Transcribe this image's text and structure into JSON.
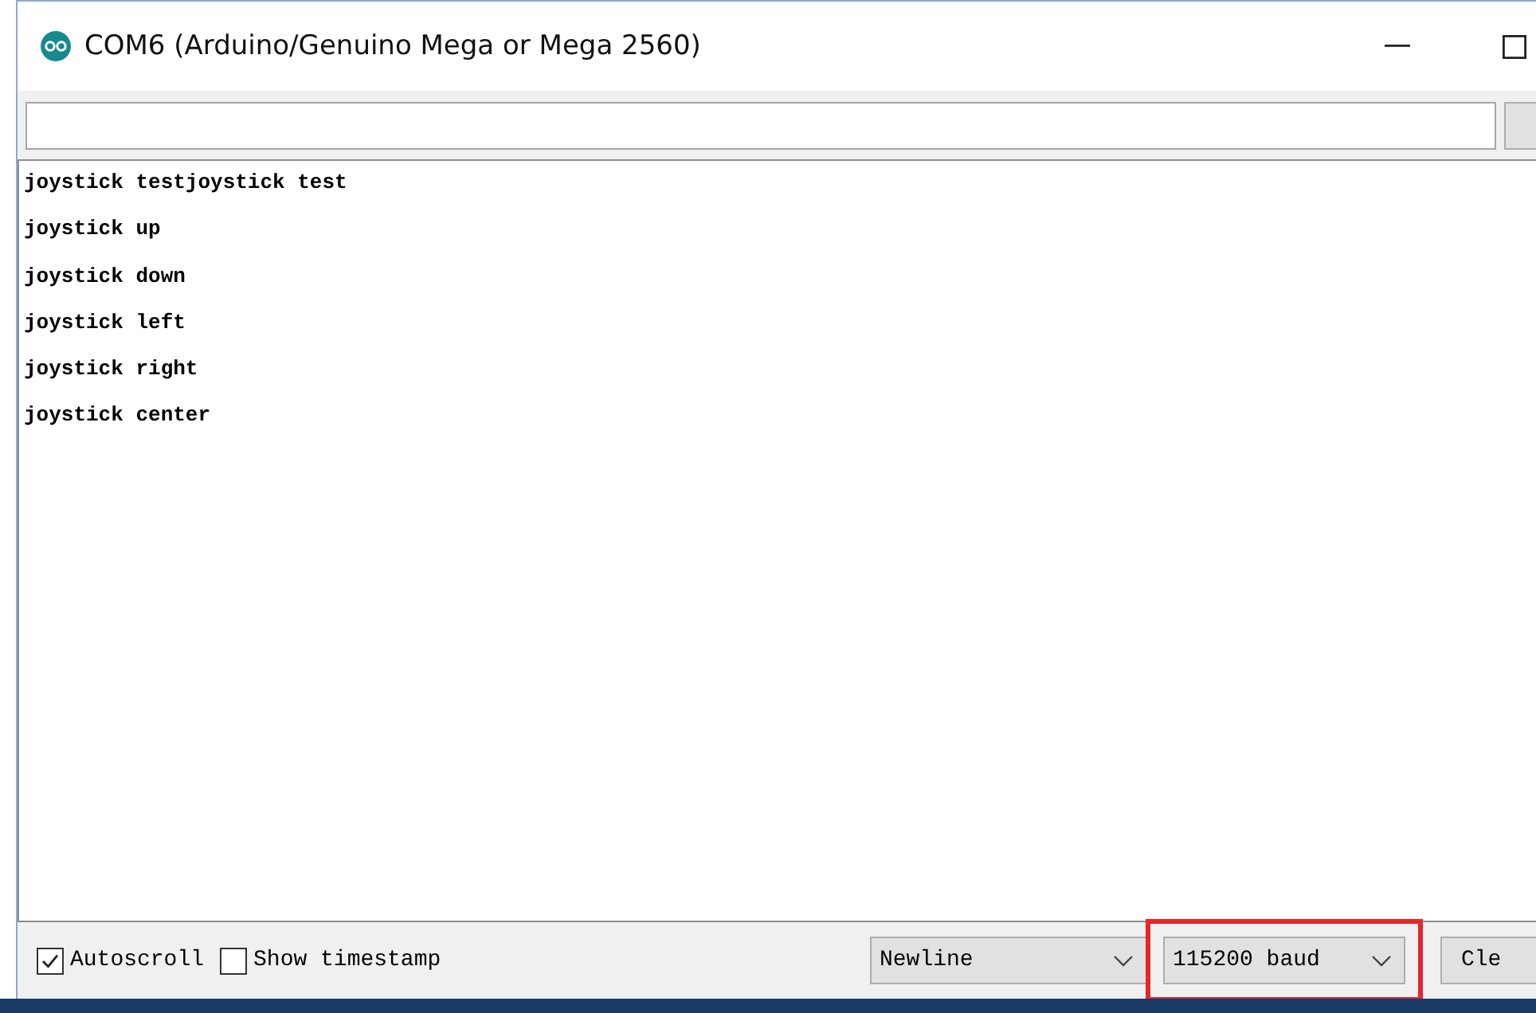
{
  "window": {
    "title": "COM6 (Arduino/Genuino Mega or Mega 2560)"
  },
  "output_lines": [
    "joystick testjoystick test",
    "joystick up",
    "joystick down",
    "joystick left",
    "joystick right",
    "joystick center"
  ],
  "bottom_bar": {
    "autoscroll": {
      "label": "Autoscroll",
      "checked": true
    },
    "timestamp": {
      "label": "Show timestamp",
      "checked": false
    },
    "line_ending": {
      "value": "Newline",
      "highlighted": false
    },
    "baud": {
      "value": "115200 baud",
      "highlighted": true
    },
    "clear_button": {
      "label": "Cle"
    }
  }
}
